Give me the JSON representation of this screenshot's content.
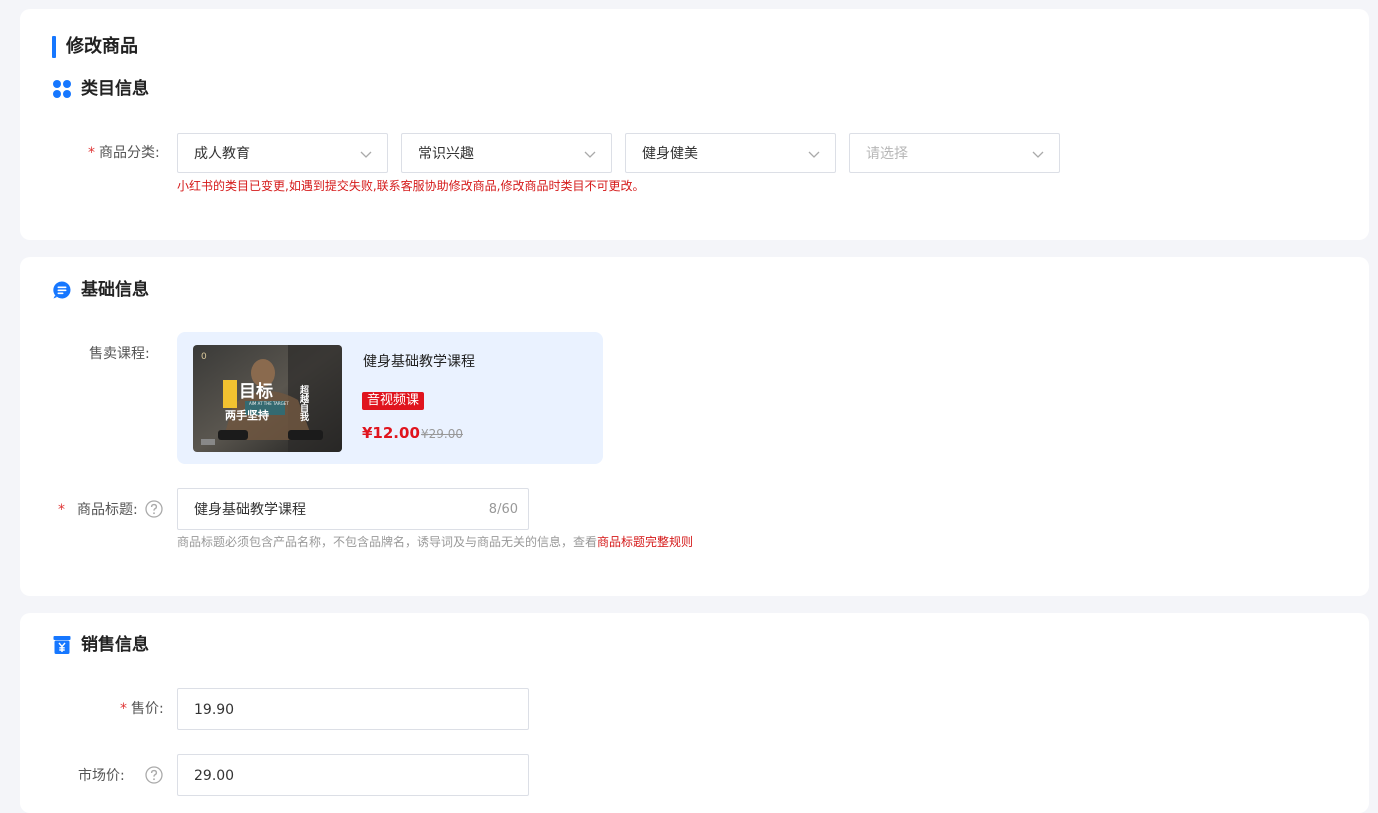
{
  "page": {
    "title": "修改商品"
  },
  "category_section": {
    "title": "类目信息",
    "field_label": "商品分类:",
    "required_mark": "*",
    "selects": [
      {
        "value": "成人教育",
        "placeholder": ""
      },
      {
        "value": "常识兴趣",
        "placeholder": ""
      },
      {
        "value": "健身健美",
        "placeholder": ""
      },
      {
        "value": "",
        "placeholder": "请选择"
      }
    ],
    "warning": "小红书的类目已变更,如遇到提交失败,联系客服协助修改商品,修改商品时类目不可更改。"
  },
  "basic_section": {
    "title": "基础信息",
    "course_label": "售卖课程:",
    "course": {
      "name": "健身基础教学课程",
      "badge": "音视频课",
      "price": "¥12.00",
      "original_price": "¥29.00",
      "thumb_text": {
        "main": "目标",
        "side": "超越自我",
        "sub": "两手坚持",
        "eng": "AIM AT THE TARGET",
        "tag": "0"
      }
    },
    "title_field": {
      "required_mark": "*",
      "label": "商品标题:",
      "value": "健身基础教学课程",
      "count": "8/60",
      "hint_prefix": "商品标题必须包含产品名称，不包含品牌名，诱导词及与商品无关的信息，查看",
      "hint_link": "商品标题完整规则"
    }
  },
  "sales_section": {
    "title": "销售信息",
    "price_field": {
      "required_mark": "*",
      "label": "售价:",
      "value": "19.90"
    },
    "market_price_field": {
      "label": "市场价:",
      "value": "29.00"
    }
  },
  "colors": {
    "accent": "#1677ff",
    "error": "#e0141e",
    "course_bg": "#eaf2ff",
    "page_bg": "#f4f5f9"
  }
}
